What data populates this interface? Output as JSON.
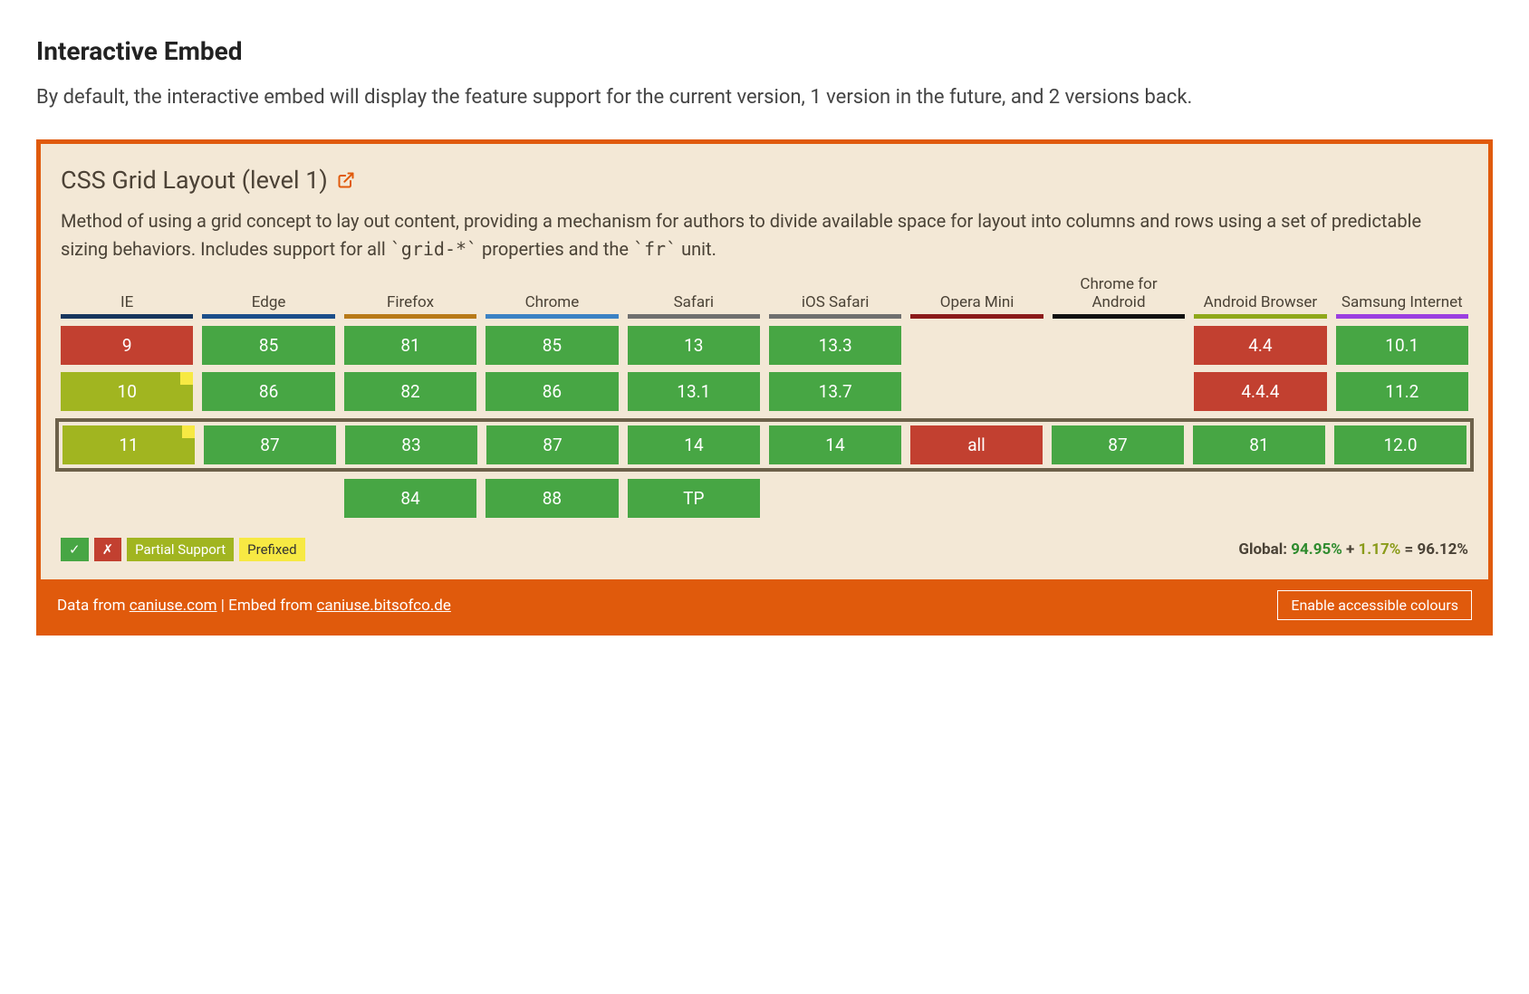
{
  "heading": "Interactive Embed",
  "intro": "By default, the interactive embed will display the feature support for the current version, 1 version in the future, and 2 versions back.",
  "feature": {
    "title": "CSS Grid Layout (level 1)",
    "description_pre": "Method of using a grid concept to lay out content, providing a mechanism for authors to divide available space for layout into columns and rows using a set of predictable sizing behaviors. Includes support for all ",
    "code1": "`grid-*`",
    "description_mid": " properties and the ",
    "code2": "`fr`",
    "description_post": " unit."
  },
  "browsers": [
    {
      "name": "IE",
      "bar": "#17365d"
    },
    {
      "name": "Edge",
      "bar": "#1b4e8a"
    },
    {
      "name": "Firefox",
      "bar": "#b87a18"
    },
    {
      "name": "Chrome",
      "bar": "#3b82c4"
    },
    {
      "name": "Safari",
      "bar": "#6f6f6f"
    },
    {
      "name": "iOS Safari",
      "bar": "#6f6f6f"
    },
    {
      "name": "Opera Mini",
      "bar": "#8b1a1a"
    },
    {
      "name": "Chrome for Android",
      "bar": "#111111"
    },
    {
      "name": "Android Browser",
      "bar": "#8fa81a"
    },
    {
      "name": "Samsung Internet",
      "bar": "#9b3fe0"
    }
  ],
  "rows": [
    [
      {
        "v": "9",
        "s": "unsupported"
      },
      {
        "v": "85",
        "s": "supported"
      },
      {
        "v": "81",
        "s": "supported"
      },
      {
        "v": "85",
        "s": "supported"
      },
      {
        "v": "13",
        "s": "supported"
      },
      {
        "v": "13.3",
        "s": "supported"
      },
      {
        "v": "",
        "s": "empty"
      },
      {
        "v": "",
        "s": "empty"
      },
      {
        "v": "4.4",
        "s": "unsupported"
      },
      {
        "v": "10.1",
        "s": "supported"
      }
    ],
    [
      {
        "v": "10",
        "s": "partial",
        "prefix": true
      },
      {
        "v": "86",
        "s": "supported"
      },
      {
        "v": "82",
        "s": "supported"
      },
      {
        "v": "86",
        "s": "supported"
      },
      {
        "v": "13.1",
        "s": "supported"
      },
      {
        "v": "13.7",
        "s": "supported"
      },
      {
        "v": "",
        "s": "empty"
      },
      {
        "v": "",
        "s": "empty"
      },
      {
        "v": "4.4.4",
        "s": "unsupported"
      },
      {
        "v": "11.2",
        "s": "supported"
      }
    ],
    [
      {
        "v": "11",
        "s": "partial",
        "prefix": true
      },
      {
        "v": "87",
        "s": "supported"
      },
      {
        "v": "83",
        "s": "supported"
      },
      {
        "v": "87",
        "s": "supported"
      },
      {
        "v": "14",
        "s": "supported"
      },
      {
        "v": "14",
        "s": "supported"
      },
      {
        "v": "all",
        "s": "unsupported"
      },
      {
        "v": "87",
        "s": "supported"
      },
      {
        "v": "81",
        "s": "supported"
      },
      {
        "v": "12.0",
        "s": "supported"
      }
    ],
    [
      {
        "v": "",
        "s": "empty"
      },
      {
        "v": "",
        "s": "empty"
      },
      {
        "v": "84",
        "s": "supported"
      },
      {
        "v": "88",
        "s": "supported"
      },
      {
        "v": "TP",
        "s": "supported"
      },
      {
        "v": "",
        "s": "empty"
      },
      {
        "v": "",
        "s": "empty"
      },
      {
        "v": "",
        "s": "empty"
      },
      {
        "v": "",
        "s": "empty"
      },
      {
        "v": "",
        "s": "empty"
      }
    ]
  ],
  "current_row_index": 2,
  "legend": {
    "check": "✓",
    "cross": "✗",
    "partial": "Partial Support",
    "prefixed": "Prefixed"
  },
  "global": {
    "label": "Global:",
    "full": "94.95%",
    "plus": "+",
    "partial": "1.17%",
    "eq": "= 96.12%"
  },
  "footer": {
    "data_from": "Data from",
    "caniuse_link": "caniuse.com",
    "sep": " | ",
    "embed_from": "Embed from",
    "bitsofco_link": "caniuse.bitsofco.de",
    "button": "Enable accessible colours"
  }
}
